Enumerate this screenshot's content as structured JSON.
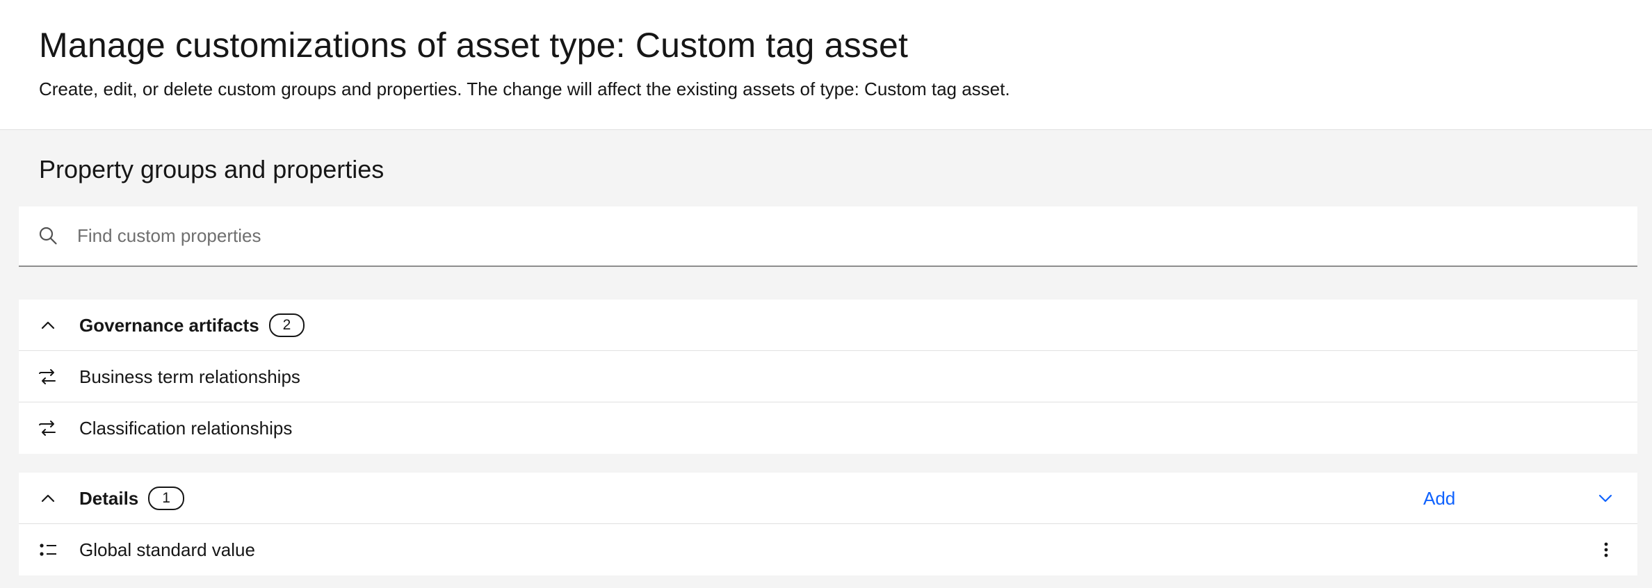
{
  "header": {
    "title": "Manage customizations of asset type: Custom tag asset",
    "subtitle": "Create, edit, or delete custom groups and properties. The change will affect the existing assets of type: Custom tag asset."
  },
  "section": {
    "heading": "Property groups and properties"
  },
  "search": {
    "placeholder": "Find custom properties",
    "value": "",
    "icon": "search-icon"
  },
  "groups": [
    {
      "name": "Governance artifacts",
      "count": "2",
      "expanded": true,
      "items": [
        {
          "label": "Business term relationships",
          "icon": "relationship-icon"
        },
        {
          "label": "Classification relationships",
          "icon": "relationship-icon"
        }
      ]
    },
    {
      "name": "Details",
      "count": "1",
      "expanded": true,
      "add_label": "Add",
      "items": [
        {
          "label": "Global standard value",
          "icon": "list-icon"
        }
      ]
    }
  ],
  "colors": {
    "link": "#0f62fe",
    "text": "#161616",
    "background": "#f4f4f4",
    "surface": "#ffffff"
  }
}
